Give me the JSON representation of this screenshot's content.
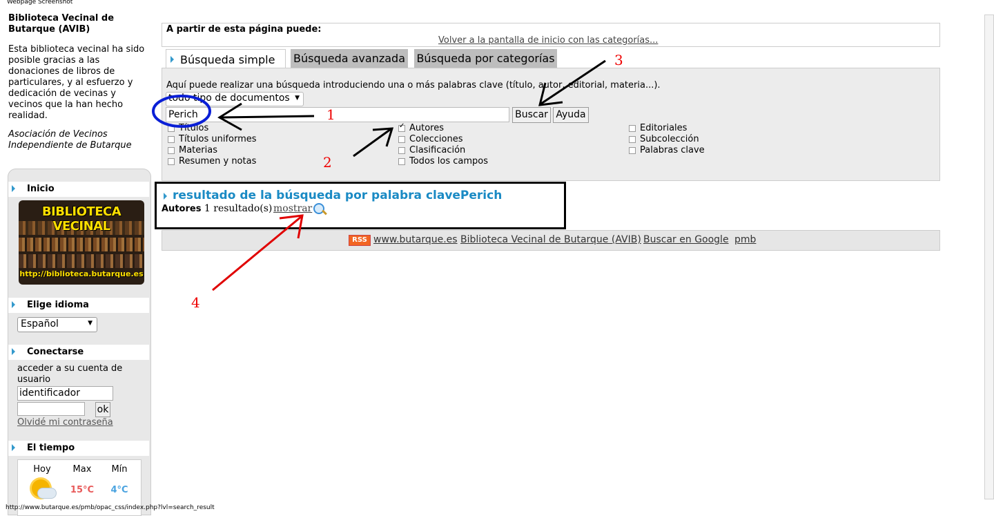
{
  "screenshot_caption": "Webpage Screenshot",
  "status_url": "http://www.butarque.es/pmb/opac_css/index.php?lvl=search_result",
  "sidebar": {
    "site_title": "Biblioteca Vecinal de Butarque (AVIB)",
    "description": "Esta biblioteca vecinal ha sido posible gracias a las donaciones de libros de particulares, y al esfuerzo y dedicación de vecinas y vecinos que la han hecho realidad.",
    "association": "Asociación de Vecinos Independiente de Butarque",
    "home_label": "Inicio",
    "banner_title": "BIBLIOTECA VECINAL",
    "banner_url": "http://biblioteca.butarque.es",
    "language_label": "Elige idioma",
    "language_value": "Español",
    "login_label": "Conectarse",
    "login_text": "acceder a su cuenta de usuario",
    "login_value": "identificador",
    "ok_label": "ok",
    "forgot_label": "Olvidé mi contraseña",
    "weather_label": "El tiempo",
    "weather": {
      "today": "Hoy",
      "max": "Max",
      "min": "Mín",
      "max_temp": "15°C",
      "min_temp": "4°C"
    }
  },
  "main": {
    "info_title": "A partir de esta página puede:",
    "info_link": "Volver a la pantalla de inicio con las categorías...",
    "tabs": [
      {
        "label": "Búsqueda simple"
      },
      {
        "label": "Búsqueda avanzada"
      },
      {
        "label": "Búsqueda por categorías"
      }
    ],
    "search_help": "Aquí puede realizar una búsqueda introduciendo una o más palabras clave (título, autor, editorial, materia...).",
    "doc_type": "todo tipo de documentos",
    "query": "Perich",
    "search_button": "Buscar",
    "help_button": "Ayuda",
    "fields": [
      {
        "label": "Títulos",
        "checked": false
      },
      {
        "label": "Títulos uniformes",
        "checked": false
      },
      {
        "label": "Materias",
        "checked": false
      },
      {
        "label": "Resumen y notas",
        "checked": false
      },
      {
        "label": "Autores",
        "checked": true
      },
      {
        "label": "Colecciones",
        "checked": false
      },
      {
        "label": "Clasificación",
        "checked": false
      },
      {
        "label": "Todos los campos",
        "checked": false
      },
      {
        "label": "Editoriales",
        "checked": false
      },
      {
        "label": "Subcolección",
        "checked": false
      },
      {
        "label": "Palabras clave",
        "checked": false
      }
    ],
    "result_title": "resultado de la búsqueda por palabra clavePerich",
    "result_category": "Autores",
    "result_count": "1 resultado(s)",
    "result_show": "mostrar"
  },
  "footer": {
    "rss": "RSS",
    "links": [
      "www.butarque.es",
      "Biblioteca Vecinal de Butarque (AVIB)",
      "Buscar en Google",
      "pmb"
    ]
  },
  "annotations": {
    "n1": "1",
    "n2": "2",
    "n3": "3",
    "n4": "4"
  },
  "colors": {
    "accent": "#3399cc",
    "result_title": "#1a8ac4",
    "tab_inactive": "#bdbdbd",
    "panel": "#ececec",
    "annotation_red": "#e00000",
    "circle_blue": "#0a1fd6"
  }
}
